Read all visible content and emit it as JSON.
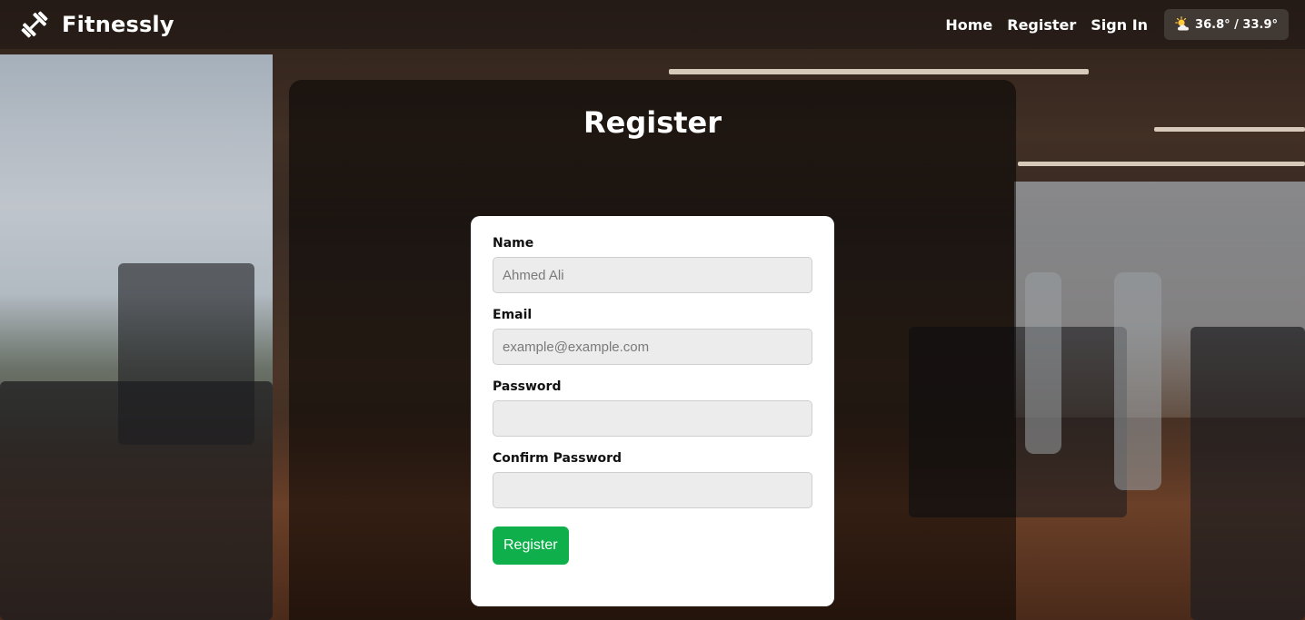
{
  "navbar": {
    "brand_name": "Fitnessly",
    "links": [
      {
        "label": "Home"
      },
      {
        "label": "Register"
      },
      {
        "label": "Sign In"
      }
    ],
    "weather": {
      "icon": "sun-behind-cloud-icon",
      "text": "36.8° / 33.9°"
    }
  },
  "main": {
    "title": "Register"
  },
  "form": {
    "fields": [
      {
        "label": "Name",
        "placeholder": "Ahmed Ali",
        "value": ""
      },
      {
        "label": "Email",
        "placeholder": "example@example.com",
        "value": ""
      },
      {
        "label": "Password",
        "placeholder": "",
        "value": ""
      },
      {
        "label": "Confirm Password",
        "placeholder": "",
        "value": ""
      }
    ],
    "submit_label": "Register"
  },
  "colors": {
    "accent_green": "#0fb04b",
    "card_background": "#ffffff",
    "input_background": "#ececec"
  }
}
